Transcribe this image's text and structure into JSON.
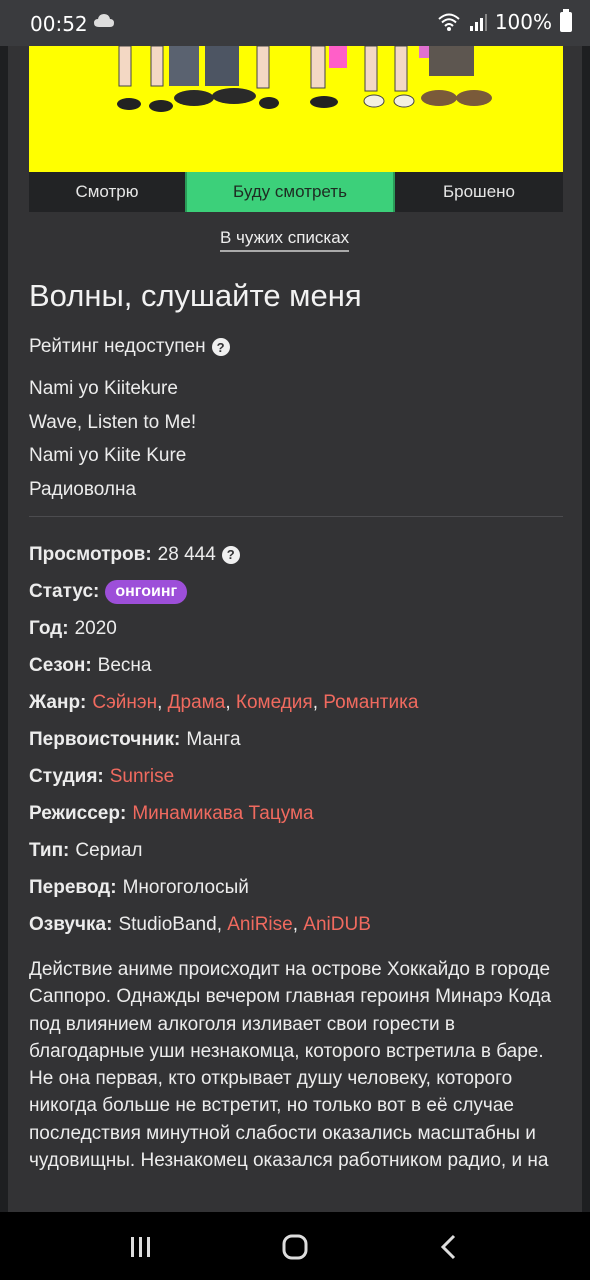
{
  "status_bar": {
    "time": "00:52",
    "battery": "100%"
  },
  "tabs": [
    {
      "label": "Смотрю",
      "active": false
    },
    {
      "label": "Буду смотреть",
      "active": true
    },
    {
      "label": "Брошено",
      "active": false
    }
  ],
  "others_link": "В чужих списках",
  "title": "Волны, слушайте меня",
  "rating_text": "Рейтинг недоступен",
  "alt_names": [
    "Nami yo Kiitekure",
    "Wave, Listen to Me!",
    "Nami yo Kiite Kure",
    "Радиоволна"
  ],
  "info": {
    "views": {
      "label": "Просмотров:",
      "value": "28 444"
    },
    "status": {
      "label": "Статус:",
      "value": "онгоинг"
    },
    "year": {
      "label": "Год:",
      "value": "2020"
    },
    "season": {
      "label": "Сезон:",
      "value": "Весна"
    },
    "genre": {
      "label": "Жанр:",
      "values": [
        "Сэйнэн",
        "Драма",
        "Комедия",
        "Романтика"
      ]
    },
    "source": {
      "label": "Первоисточник:",
      "value": "Манга"
    },
    "studio": {
      "label": "Студия:",
      "value": "Sunrise"
    },
    "director": {
      "label": "Режиссер:",
      "value": "Минамикава Тацума"
    },
    "type": {
      "label": "Тип:",
      "value": "Сериал"
    },
    "translation": {
      "label": "Перевод:",
      "value": "Многоголосый"
    },
    "voice": {
      "label": "Озвучка:",
      "plain": "StudioBand",
      "links": [
        "AniRise",
        "AniDUB"
      ]
    }
  },
  "description": "Действие аниме происходит на острове Хоккайдо в городе Саппоро. Однажды вечером главная героиня Минарэ Кода под влиянием алкоголя изливает свои горести в благодарные уши незнакомца, которого встретила в баре. Не она первая, кто открывает душу человеку, которого никогда больше не встретит, но только вот в её случае последствия минутной слабости оказались масштабны и чудовищны. Незнакомец оказался работником радио, и на",
  "colors": {
    "accent_green": "#3cd07a",
    "link": "#f06a5f",
    "badge": "#9d4fd9",
    "poster_bg": "#ffff00"
  },
  "icons": [
    "cloud-icon",
    "wifi-icon",
    "signal-icon",
    "battery-icon",
    "help-icon",
    "recents-icon",
    "home-icon",
    "back-icon"
  ]
}
